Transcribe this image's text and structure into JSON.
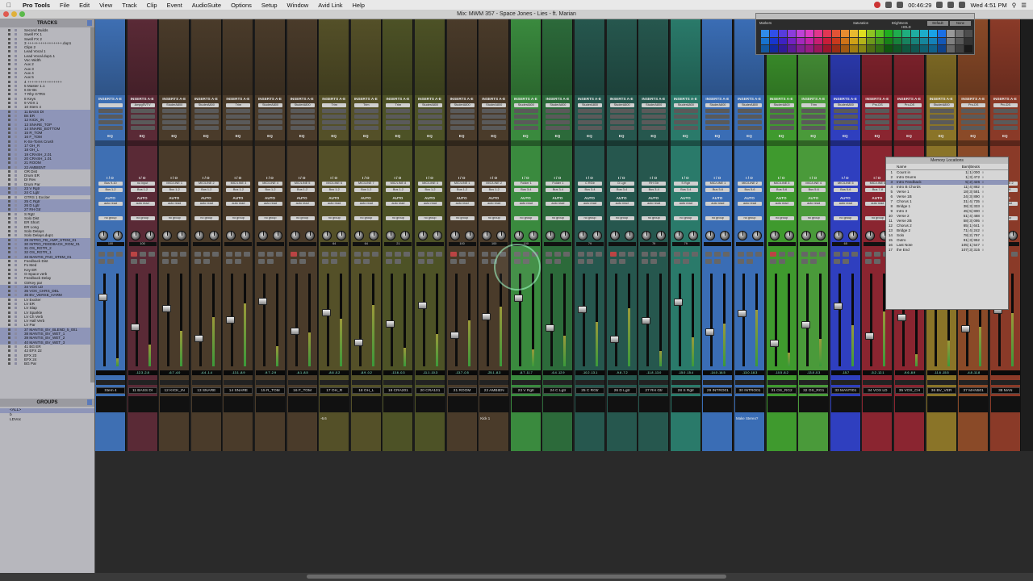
{
  "menubar": {
    "app": "Pro Tools",
    "items": [
      "File",
      "Edit",
      "View",
      "Track",
      "Clip",
      "Event",
      "AudioSuite",
      "Options",
      "Setup",
      "Window",
      "Avid Link",
      "Help"
    ],
    "clock": "00:46:29",
    "datetime": "Wed 4:51 PM"
  },
  "window": {
    "title": "Mix: MWM 357 - Space Jones - Lies - ft. Marian"
  },
  "tracks_panel": {
    "title": "TRACKS",
    "items": [
      {
        "name": "Second Builds",
        "sel": false
      },
      {
        "name": "Swell FX 1",
        "sel": false
      },
      {
        "name": "Swell FX 2",
        "sel": false
      },
      {
        "name": "3 ++++++++++++++++.dup1",
        "sel": false
      },
      {
        "name": "Clips 2",
        "sel": false
      },
      {
        "name": "Lead Vocal 1",
        "sel": false
      },
      {
        "name": "Lead Vocal.dup1.1",
        "sel": false
      },
      {
        "name": "Voc Width",
        "sel": false
      },
      {
        "name": "Aux 2",
        "sel": false
      },
      {
        "name": "Aux 3",
        "sel": false
      },
      {
        "name": "Aux 4",
        "sel": false
      },
      {
        "name": "Aux 5",
        "sel": false
      },
      {
        "name": "4 ++++++++++++++++",
        "sel": false
      },
      {
        "name": "5 Master 1.1",
        "sel": false
      },
      {
        "name": "6 Dr-Bs",
        "sel": false
      },
      {
        "name": "7 Rhy GTRS",
        "sel": false
      },
      {
        "name": "8 Keys",
        "sel": false
      },
      {
        "name": "9 VOX 1",
        "sel": false
      },
      {
        "name": "10 Stem 4",
        "sel": false
      },
      {
        "name": "11 BASS DI",
        "sel": true
      },
      {
        "name": "Bs ER",
        "sel": true
      },
      {
        "name": "12 KICK_IN",
        "sel": true
      },
      {
        "name": "13 SNARE_TOP",
        "sel": true
      },
      {
        "name": "14 SNARE_BOTTOM",
        "sel": true
      },
      {
        "name": "15 R_TOM",
        "sel": true
      },
      {
        "name": "16 F_TOM",
        "sel": true
      },
      {
        "name": "K-Sn-Toms Crush",
        "sel": true
      },
      {
        "name": "17 OH_R",
        "sel": true
      },
      {
        "name": "18 OH_L",
        "sel": true
      },
      {
        "name": "19 CRASH_2.01",
        "sel": true
      },
      {
        "name": "20 CRASH_1.01",
        "sel": true
      },
      {
        "name": "21 ROOM",
        "sel": true
      },
      {
        "name": "22 AMBIENT",
        "sel": true
      },
      {
        "name": "OR Dist",
        "sel": false
      },
      {
        "name": "Drum ER",
        "sel": false
      },
      {
        "name": "Dr Rev",
        "sel": false
      },
      {
        "name": "Drum Par",
        "sel": false
      },
      {
        "name": "23 V Rgtr",
        "sel": true
      },
      {
        "name": "24 C Lgtr",
        "sel": true
      },
      {
        "name": "GTRS 1 Exciter",
        "sel": false
      },
      {
        "name": "25 C Rgtr",
        "sel": true
      },
      {
        "name": "26 D Lgtr",
        "sel": true
      },
      {
        "name": "27 RH Gtr",
        "sel": true
      },
      {
        "name": "S Rgtr",
        "sel": false
      },
      {
        "name": "Solo Dist",
        "sel": false
      },
      {
        "name": "ER Short",
        "sel": false
      },
      {
        "name": "ER Long",
        "sel": false
      },
      {
        "name": "Solo Delays",
        "sel": false
      },
      {
        "name": "Solo Delays.dup1",
        "sel": false
      },
      {
        "name": "29 INTRO_FB_AMP_STEM_01",
        "sel": true
      },
      {
        "name": "30 INTRO_FEEDBACK_ROM_01",
        "sel": true
      },
      {
        "name": "31 OS_RGTR_2",
        "sel": true
      },
      {
        "name": "32 OS_RGTR_1",
        "sel": true
      },
      {
        "name": "33 MANTIS_PAD_STEM_01",
        "sel": true
      },
      {
        "name": "Feedback Dist",
        "sel": false
      },
      {
        "name": "Fx Med",
        "sel": false
      },
      {
        "name": "Key ER",
        "sel": false
      },
      {
        "name": "G-Space verb",
        "sel": false
      },
      {
        "name": "Feedback Delay",
        "sel": false
      },
      {
        "name": "GtrKey par",
        "sel": false
      },
      {
        "name": "34 VOX LD",
        "sel": true
      },
      {
        "name": "35 VOX_CHRS_DBL",
        "sel": true
      },
      {
        "name": "36 BV_VERSE_HARM",
        "sel": true
      },
      {
        "name": "LV Exciter",
        "sel": false
      },
      {
        "name": "LV ER",
        "sel": false
      },
      {
        "name": "LV Slap",
        "sel": false
      },
      {
        "name": "LV Sparkle",
        "sel": false
      },
      {
        "name": "LV Ch Verb",
        "sel": false
      },
      {
        "name": "LV Hall Verb",
        "sel": false
      },
      {
        "name": "LV Par",
        "sel": false
      },
      {
        "name": "37 MANTIS_BV_BLEND_5_001",
        "sel": true
      },
      {
        "name": "38 MANTIS_BV_WET_1",
        "sel": true
      },
      {
        "name": "39 MANTIS_BV_WET_2",
        "sel": true
      },
      {
        "name": "40 MANTIS_BV_WET_3",
        "sel": true
      },
      {
        "name": "41 BG ER",
        "sel": false
      },
      {
        "name": "42 EFX 22",
        "sel": false
      },
      {
        "name": "EFX 23",
        "sel": false
      },
      {
        "name": "EFX 24",
        "sel": false
      },
      {
        "name": "BG Par",
        "sel": false
      }
    ]
  },
  "groups_panel": {
    "title": "GROUPS",
    "items": [
      {
        "name": "<ALL>",
        "sel": true
      },
      {
        "name": "b",
        "sel": false
      },
      {
        "name": "LDVoc",
        "sel": false
      }
    ]
  },
  "strips": [
    {
      "color": "#3e6fb3",
      "name": "Stem 4",
      "insert": "",
      "input": "Bus 9-10",
      "output": "Bus 1-2",
      "pan": "100",
      "vol": "",
      "comment": ""
    },
    {
      "color": "#5a2a36",
      "name": "11 BASS DI",
      "insert": "AmpgSVTV",
      "input": "no input",
      "output": "Bus 1-2",
      "pan": "100",
      "vol": "-12.3  -2.8",
      "comment": ""
    },
    {
      "color": "#4a3b2a",
      "name": "12 KICK_IN",
      "insert": "StuderA800",
      "input": "MIC/LINE 1",
      "output": "Bus 1-2",
      "pan": "",
      "vol": "-6.7  -4.0",
      "comment": ""
    },
    {
      "color": "#4a3b2a",
      "name": "13 SNARE",
      "insert": "StuderA800",
      "input": "MIC/LINE 2",
      "output": "Bus 1-2",
      "pan": "",
      "vol": "-4.4  -1.4",
      "comment": ""
    },
    {
      "color": "#4a3b2a",
      "name": "14 SNARE",
      "insert": "Trim",
      "input": "MIC/LINE 3",
      "output": "Bus 1-2",
      "pan": "",
      "vol": "-13.1  -8.9",
      "comment": ""
    },
    {
      "color": "#4a3b2a",
      "name": "15 R_TOM",
      "insert": "StuderA800",
      "input": "MIC/LINE 4",
      "output": "Bus 1-2",
      "pan": "",
      "vol": "-9.7  -2.9",
      "comment": ""
    },
    {
      "color": "#4a3b2a",
      "name": "16 F_TOM",
      "insert": "StuderA800",
      "input": "MIC/LINE 5",
      "output": "Bus 1-2",
      "pan": "",
      "vol": "-6.1  -8.5",
      "comment": ""
    },
    {
      "color": "#545028",
      "name": "17 OH_R",
      "insert": "Trim",
      "input": "MIC/LINE 6",
      "output": "Bus 1-2",
      "pan": "64",
      "vol": "-8.6  -0.2",
      "comment": "-6.6"
    },
    {
      "color": "#545028",
      "name": "18 OH_L",
      "insert": "Trim",
      "input": "MIC/LINE 7",
      "output": "Bus 1-2",
      "pan": "64",
      "vol": "-8.9  -0.2",
      "comment": ""
    },
    {
      "color": "#4d5226",
      "name": "19 CRA201",
      "insert": "Trim",
      "input": "MIC/LINE 8",
      "output": "Bus 1-2",
      "pan": "21",
      "vol": "-13.6  -0.3",
      "comment": ""
    },
    {
      "color": "#4d5226",
      "name": "20 CRA101",
      "insert": "StuderA800",
      "input": "MIC/LINE 3",
      "output": "Bus 1-2",
      "pan": "",
      "vol": "-11.1  -10.3",
      "comment": ""
    },
    {
      "color": "#4a3b2a",
      "name": "21 ROOM",
      "insert": "StuderA800",
      "input": "MIC/LINE 1",
      "output": "Bus 1-2",
      "pan": "100",
      "vol": "-13.7  -0.5",
      "comment": ""
    },
    {
      "color": "#4a3b2a",
      "name": "22 AMBIEN",
      "insert": "StuderA800",
      "input": "MIC/LINE 2",
      "output": "Bus 1-2",
      "pan": "100",
      "vol": "-25.1  -8.3",
      "comment": "Kick 1"
    },
    {
      "color": "#3a8a3e",
      "name": "23 V Rgtr",
      "insert": "StuderA800",
      "input": "Folder 1",
      "output": "Bus 3-4",
      "pan": "100",
      "vol": "-8.7  -11.7",
      "comment": ""
    },
    {
      "color": "#2c6a3a",
      "name": "24 C Lgtr",
      "insert": "StuderA800",
      "input": "Folder 1",
      "output": "Bus 3-4",
      "pan": "",
      "vol": "-6.4  -12.9",
      "comment": ""
    },
    {
      "color": "#26574e",
      "name": "25 C RGtr",
      "insert": "StuderA800",
      "input": "C RGtr",
      "output": "Bus 3-4",
      "pan": "79",
      "vol": "-10.2  -13.1",
      "comment": ""
    },
    {
      "color": "#26574e",
      "name": "26 D Lgtr",
      "insert": "StuderA800",
      "input": "D Lgtr",
      "output": "Bus 3-4",
      "pan": "",
      "vol": "-9.8  -7.2",
      "comment": ""
    },
    {
      "color": "#26574e",
      "name": "27 RH Gtr",
      "insert": "StuderA800",
      "input": "RH Gtr",
      "output": "Bus 3-4",
      "pan": "79",
      "vol": "-11.8  -13.0",
      "comment": ""
    },
    {
      "color": "#2a7a6a",
      "name": "28 S Rgtr",
      "insert": "StuderA800",
      "input": "S Rgtr",
      "output": "Bus 3-4",
      "pan": "79",
      "vol": "-15.0  -15.4",
      "comment": ""
    },
    {
      "color": "#3a6db5",
      "name": "29 INTRO01",
      "insert": "StuderA800",
      "input": "MIC/LINE 1",
      "output": "Bus 5-6",
      "pan": "",
      "vol": "-14.0  -16.5",
      "comment": ""
    },
    {
      "color": "#3a6db5",
      "name": "30 INTRO01",
      "insert": "StuderA800",
      "input": "MIC/LINE 2",
      "output": "Bus 5-6",
      "pan": "",
      "vol": "-13.0  -18.3",
      "comment": "Make Stereo?"
    },
    {
      "color": "#3f9a2e",
      "name": "31 OS_RG2",
      "insert": "StuderA800",
      "input": "MIC/LINE 3",
      "output": "Bus 5-6",
      "pan": "",
      "vol": "-10.5  -8.2",
      "comment": ""
    },
    {
      "color": "#4a9a3a",
      "name": "32 OS_RG1",
      "insert": "Trim",
      "input": "MIC/LINE 4",
      "output": "Bus 5-6",
      "pan": "",
      "vol": "-13.8  -0.3",
      "comment": ""
    },
    {
      "color": "#2f3fbf",
      "name": "33 MANTI01",
      "insert": "StuderA800",
      "input": "MIC/LINE 5",
      "output": "Bus 5-6",
      "pan": "65",
      "vol": "-15.7",
      "comment": ""
    },
    {
      "color": "#8a2530",
      "name": "34 VOX LD",
      "insert": "Pro-DS",
      "input": "MIC/LINE 6",
      "output": "Bus 7-8",
      "pan": "",
      "vol": "-5.2  -12.1",
      "comment": ""
    },
    {
      "color": "#8a2530",
      "name": "35 VOX_CH",
      "insert": "Pro-DS",
      "input": "MIC/LINE 7",
      "output": "Bus 7-8",
      "pan": "",
      "vol": "-9.6  -8.9",
      "comment": ""
    },
    {
      "color": "#8a7428",
      "name": "36 BV_VER",
      "insert": "StuderA800",
      "input": "MIC/LINE 8",
      "output": "Bus 7-8",
      "pan": "",
      "vol": "-11.6  -15.5",
      "comment": ""
    },
    {
      "color": "#8a4a28",
      "name": "37 MAN501",
      "insert": "Pro-DS",
      "input": "MIC/LINE 1",
      "output": "Bus 7-8",
      "pan": "",
      "vol": "-4.8  -11.8",
      "comment": ""
    },
    {
      "color": "#8a3a28",
      "name": "38 MAN",
      "insert": "Pro-DS",
      "input": "MIC/LINE 2",
      "output": "Bus 7-8",
      "pan": "",
      "vol": "",
      "comment": ""
    }
  ],
  "strip_labels": {
    "inserts": "INSERTS A-E",
    "eq": "EQ",
    "io": "I / O",
    "auto": "AUTO",
    "auto_mode": "auto read",
    "group": "no group"
  },
  "color_palette": {
    "title": "Markers",
    "saturation_label": "Saturation",
    "brightness_label": "Brightness",
    "hold": "HOLD",
    "default": "Default",
    "none": "None"
  },
  "memory_locations": {
    "title": "Memory Locations",
    "col_name": "Name",
    "col_bars": "Bars|Beats",
    "rows": [
      {
        "num": "1",
        "name": "Count in",
        "pos": "1| 1| 000",
        "sel": false
      },
      {
        "num": "2",
        "name": "Intro Drums",
        "pos": "1| 3| 472",
        "sel": false
      },
      {
        "num": "3",
        "name": "Intro Feedback",
        "pos": "5| 2| 426",
        "sel": true
      },
      {
        "num": "4",
        "name": "Intro B Chords",
        "pos": "11| 4| 882",
        "sel": false
      },
      {
        "num": "5",
        "name": "Verse 1",
        "pos": "18| 3| 581",
        "sel": false
      },
      {
        "num": "6",
        "name": "Verse 1B",
        "pos": "24| 3| 890",
        "sel": false
      },
      {
        "num": "7",
        "name": "Chorus 1",
        "pos": "31| 4| 735",
        "sel": false
      },
      {
        "num": "8",
        "name": "Bridge 1",
        "pos": "38| 3| 333",
        "sel": false
      },
      {
        "num": "9",
        "name": "Intro 3",
        "pos": "45| 5| 800",
        "sel": false
      },
      {
        "num": "10",
        "name": "Verse 2",
        "pos": "51| 4| 488",
        "sel": false
      },
      {
        "num": "11",
        "name": "Verse 2B",
        "pos": "58| 3| 095",
        "sel": false
      },
      {
        "num": "12",
        "name": "Chorus 2",
        "pos": "65| 1| 641",
        "sel": false
      },
      {
        "num": "13",
        "name": "Bridge 2",
        "pos": "71| 4| 242",
        "sel": false
      },
      {
        "num": "14",
        "name": "Solo",
        "pos": "78| 2| 797",
        "sel": false
      },
      {
        "num": "15",
        "name": "Outro",
        "pos": "91| 3| 952",
        "sel": false
      },
      {
        "num": "16",
        "name": "Last Note",
        "pos": "105| 1| 547",
        "sel": false
      },
      {
        "num": "17",
        "name": "the End",
        "pos": "107| 3| 315",
        "sel": false
      }
    ]
  }
}
